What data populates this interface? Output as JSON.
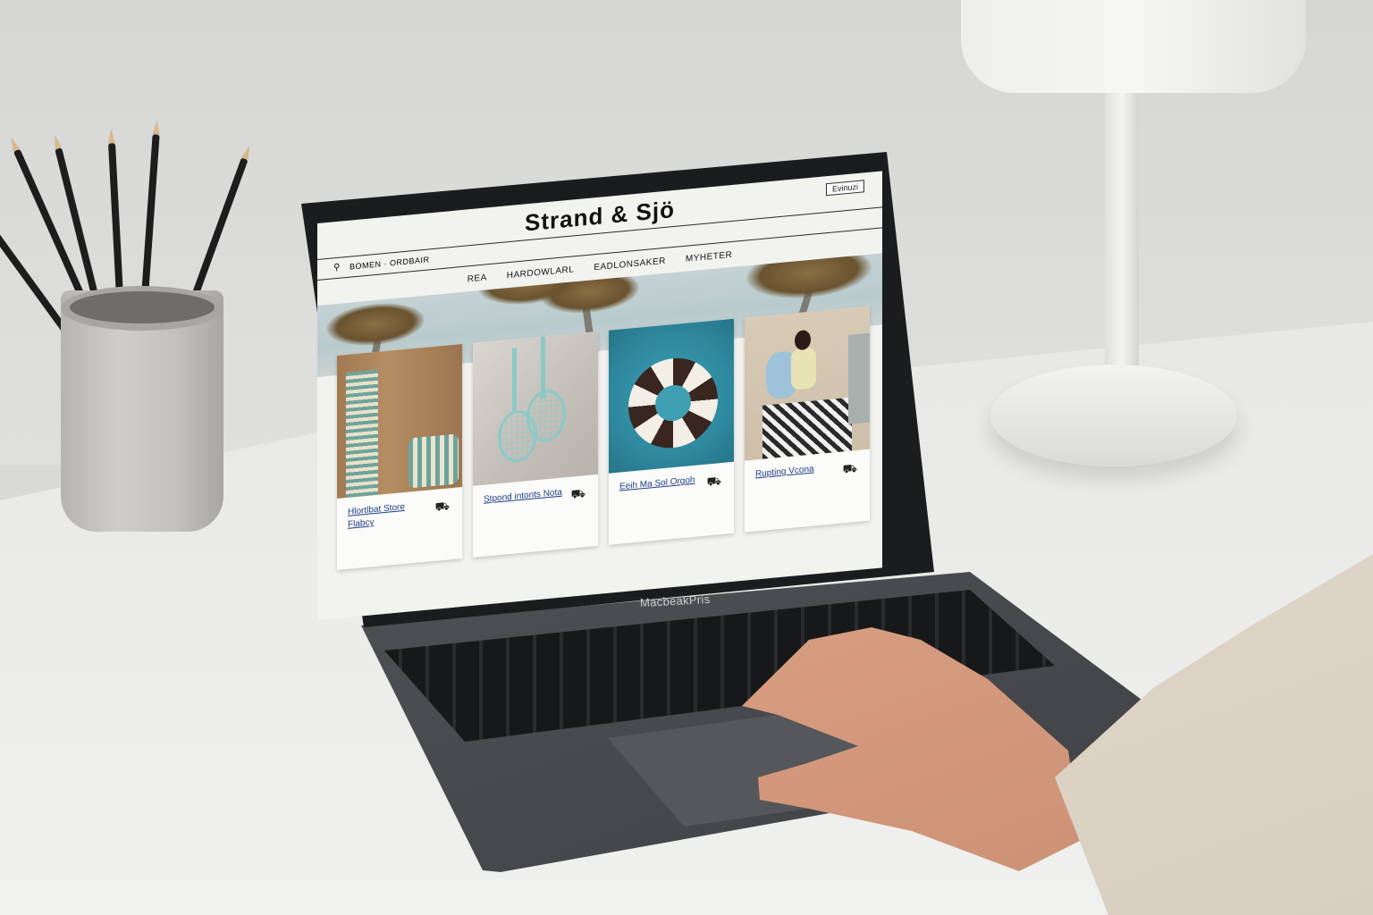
{
  "site": {
    "title": "Strand & Sjö",
    "header_button": "Evinuzi",
    "breadcrumb": "BOMEN · ORDBAIR",
    "nav": [
      "REA",
      "HARDOWLARL",
      "EADLONSAKER",
      "MYHETER"
    ]
  },
  "products": [
    {
      "name": "Hlortlbat Store Flabcy",
      "image": "striped-towel"
    },
    {
      "name": "Stpond intonts Nota",
      "image": "badminton-rackets"
    },
    {
      "name": "Eeih Ma Sol Orgoh",
      "image": "striped-swim-ring"
    },
    {
      "name": "Rupting Vcona",
      "image": "woman-with-float"
    }
  ],
  "laptop": {
    "brand_label": "MacbeakPris"
  },
  "icons": {
    "breadcrumb_icon": "user-icon",
    "cart_icon": "cart-icon"
  },
  "colors": {
    "screen_bg": "#f2f2ef",
    "link": "#1f3c8a",
    "laptop_body": "#4a4c50",
    "wall": "#d6d6d4",
    "desk": "#e8e8e6"
  }
}
